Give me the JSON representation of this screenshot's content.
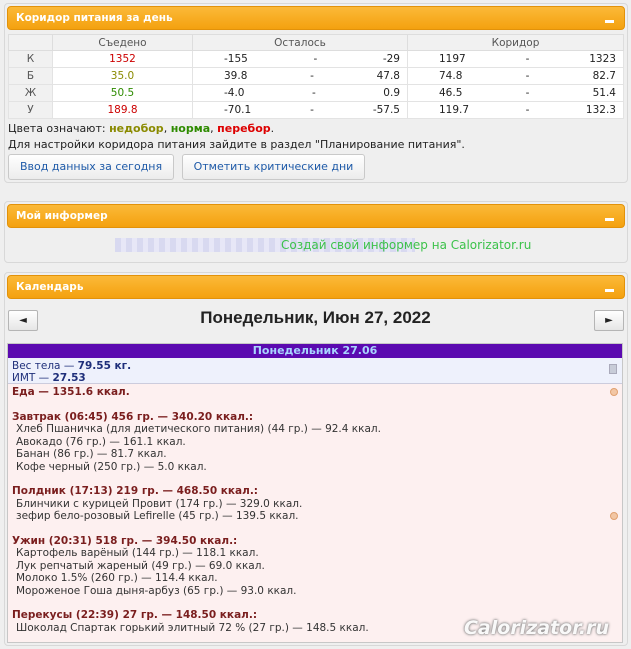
{
  "corridor_panel": {
    "title": "Коридор питания за день",
    "headers": [
      "Съедено",
      "Осталось",
      "Коридор"
    ],
    "rows": [
      {
        "label": "К",
        "eaten": "1352",
        "rem_from": "-155",
        "rem_to": "-29",
        "cor_from": "1197",
        "cor_to": "1323",
        "status": "over"
      },
      {
        "label": "Б",
        "eaten": "35.0",
        "rem_from": "39.8",
        "rem_to": "47.8",
        "cor_from": "74.8",
        "cor_to": "82.7",
        "status": "under"
      },
      {
        "label": "Ж",
        "eaten": "50.5",
        "rem_from": "-4.0",
        "rem_to": "0.9",
        "cor_from": "46.5",
        "cor_to": "51.4",
        "status": "norm"
      },
      {
        "label": "У",
        "eaten": "189.8",
        "rem_from": "-70.1",
        "rem_to": "-57.5",
        "cor_from": "119.7",
        "cor_to": "132.3",
        "status": "over"
      }
    ],
    "sep": "-",
    "legend_prefix": "Цвета означают: ",
    "legend_under": "недобор",
    "legend_comma1": ", ",
    "legend_norm": "норма",
    "legend_comma2": ", ",
    "legend_over": "перебор",
    "legend_end": ".",
    "hint": "Для настройки коридора питания зайдите в раздел \"Планирование питания\".",
    "btn_input": "Ввод данных за сегодня",
    "btn_critical": "Отметить критические дни"
  },
  "colors": {
    "under": "#8a8a00",
    "norm": "#2e8b00",
    "over": "#cc0000",
    "accent": "#f4a10f"
  },
  "informer_panel": {
    "title": "Мой информер",
    "link": "Создай свой информер на Calorizator.ru"
  },
  "calendar_panel": {
    "title": "Календарь",
    "prev": "◄",
    "next": "►",
    "date": "Понедельник, Июн 27, 2022",
    "day_title": "Понедельник 27.06",
    "weight_label": "Вес тела — ",
    "weight_value": "79.55 кг.",
    "bmi_label": "ИМТ — ",
    "bmi_value": "27.53",
    "food_total": "Еда — 1351.6 ккал.",
    "meals": [
      {
        "head": "Завтрак (06:45) 456 гр. — 340.20 ккал.:",
        "items": [
          "Хлеб Пшаничка (для диетического питания) (44 гр.) — 92.4 ккал.",
          "Авокадо (76 гр.) — 161.1 ккал.",
          "Банан (86 гр.) — 81.7 ккал.",
          "Кофе черный (250 гр.) — 5.0 ккал."
        ]
      },
      {
        "head": "Полдник (17:13) 219 гр. — 468.50 ккал.:",
        "items": [
          "Блинчики с курицей Провит (174 гр.) — 329.0 ккал.",
          "зефир бело-розовый Lefirelle (45 гр.) — 139.5 ккал."
        ]
      },
      {
        "head": "Ужин (20:31) 518 гр. — 394.50 ккал.:",
        "items": [
          "Картофель варёный (144 гр.) — 118.1 ккал.",
          "Лук репчатый жареный (49 гр.) — 69.0 ккал.",
          "Молоко 1.5% (260 гр.) — 114.4 ккал.",
          "Мороженое Гоша дыня-арбуз (65 гр.) — 93.0 ккал."
        ]
      },
      {
        "head": "Перекусы (22:39) 27 гр. — 148.50 ккал.:",
        "items": [
          "Шоколад Спартак горький элитный 72 % (27 гр.) — 148.5 ккал."
        ]
      }
    ]
  },
  "watermark": "Calorizator.ru"
}
